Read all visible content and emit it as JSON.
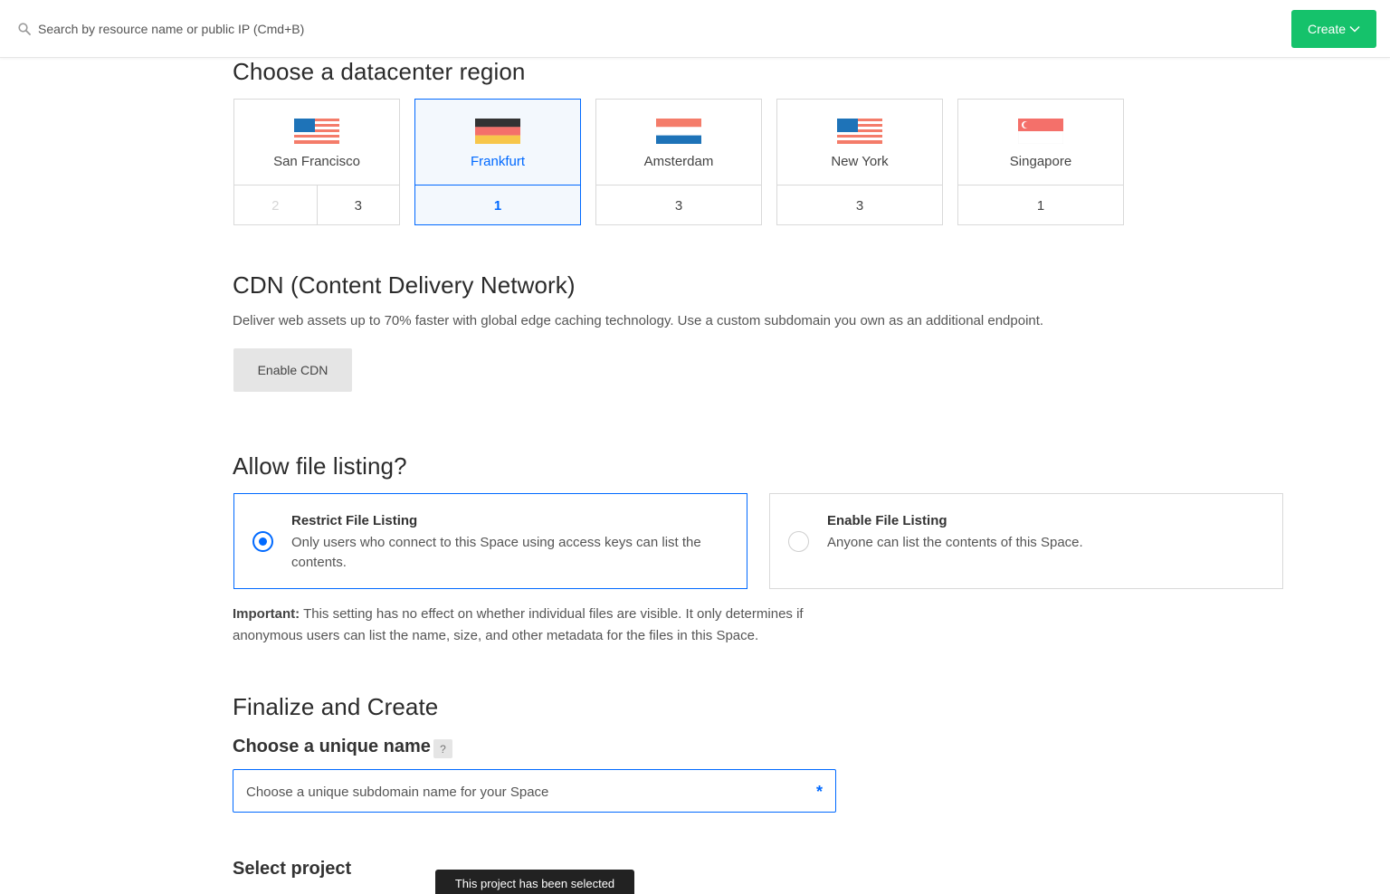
{
  "search": {
    "placeholder": "Search by resource name or public IP (Cmd+B)"
  },
  "header": {
    "create_label": "Create"
  },
  "region_section": {
    "title": "Choose a datacenter region",
    "regions": [
      {
        "name": "San Francisco",
        "flag": "us-flag-icon",
        "datacenters": [
          "2",
          "3"
        ],
        "disabled": [
          "2"
        ],
        "selected": false
      },
      {
        "name": "Frankfurt",
        "flag": "de-flag-icon",
        "datacenters": [
          "1"
        ],
        "selected": true
      },
      {
        "name": "Amsterdam",
        "flag": "nl-flag-icon",
        "datacenters": [
          "3"
        ],
        "selected": false
      },
      {
        "name": "New York",
        "flag": "us-flag-icon",
        "datacenters": [
          "3"
        ],
        "selected": false
      },
      {
        "name": "Singapore",
        "flag": "sg-flag-icon",
        "datacenters": [
          "1"
        ],
        "selected": false
      }
    ]
  },
  "cdn": {
    "title": "CDN (Content Delivery Network)",
    "description": "Deliver web assets up to 70% faster with global edge caching technology. Use a custom subdomain you own as an additional endpoint.",
    "button_label": "Enable CDN"
  },
  "file_listing": {
    "title": "Allow file listing?",
    "options": [
      {
        "title": "Restrict File Listing",
        "description": "Only users who connect to this Space using access keys can list the contents.",
        "selected": true
      },
      {
        "title": "Enable File Listing",
        "description": "Anyone can list the contents of this Space.",
        "selected": false
      }
    ],
    "important_label": "Important:",
    "important_text": " This setting has no effect on whether individual files are visible. It only determines if anonymous users can list the name, size, and other metadata for the files in this Space."
  },
  "finalize": {
    "title": "Finalize and Create",
    "name_label": "Choose a unique name",
    "help": "?",
    "name_placeholder": "Choose a unique subdomain name for your Space",
    "required_mark": "*",
    "project_label": "Select project",
    "tooltip": "This project has been selected"
  },
  "colors": {
    "accent": "#0069ff",
    "create": "#15c26b"
  }
}
